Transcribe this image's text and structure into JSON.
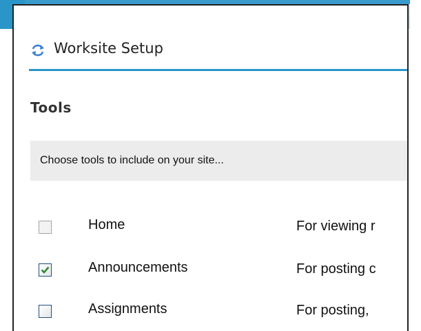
{
  "header": {
    "title": "Worksite Setup",
    "icon": "sync-arrows-icon"
  },
  "section": {
    "title": "Tools"
  },
  "instructions": {
    "text": "Choose tools to include on your site..."
  },
  "tools": [
    {
      "name": "Home",
      "description": "For viewing r",
      "checked": false,
      "disabled": true
    },
    {
      "name": "Announcements",
      "description": "For posting c",
      "checked": true,
      "disabled": false
    },
    {
      "name": "Assignments",
      "description": "For posting,",
      "checked": false,
      "disabled": false
    }
  ],
  "colors": {
    "accent": "#2a95c9",
    "checkmark": "#2e8b2e",
    "panel": "#ececec"
  }
}
